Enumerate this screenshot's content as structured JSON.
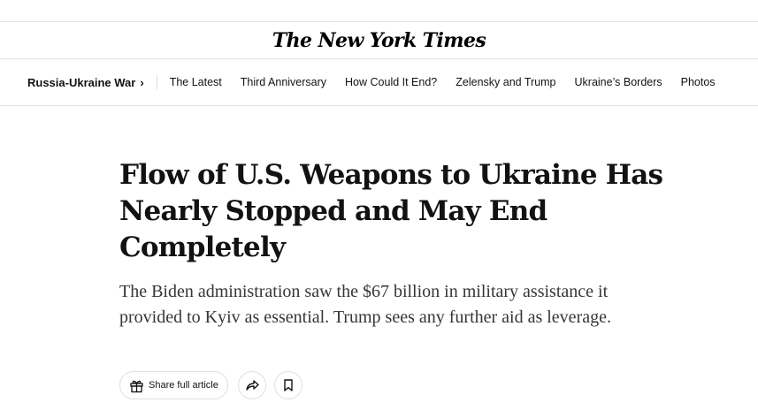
{
  "masthead": {
    "logo_text": "The New York Times"
  },
  "nav": {
    "section_label": "Russia-Ukraine War",
    "section_chevron": "›",
    "items": [
      "The Latest",
      "Third Anniversary",
      "How Could It End?",
      "Zelensky and Trump",
      "Ukraine’s Borders",
      "Photos"
    ]
  },
  "article": {
    "headline": "Flow of U.S. Weapons to Ukraine Has Nearly Stopped and May End Completely",
    "summary": "The Biden administration saw the $67 billion in military assistance it provided to Kyiv as essential. Trump sees any further aid as leverage."
  },
  "actions": {
    "share_full_article_label": "Share full article",
    "share_full_article_icon": "gift-icon",
    "share_icon": "share-arrow-icon",
    "save_icon": "bookmark-icon"
  }
}
